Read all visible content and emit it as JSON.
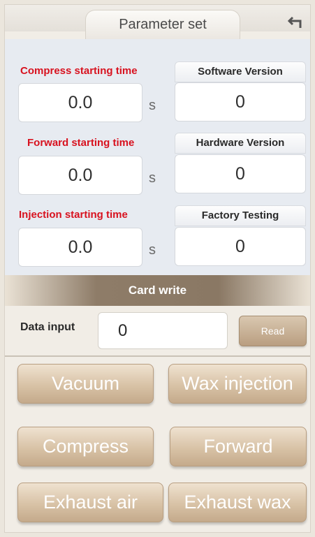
{
  "header": {
    "title": "Parameter set",
    "back_icon": "back-arrow-icon"
  },
  "params": {
    "compress": {
      "label": "Compress starting time",
      "value": "0.0",
      "unit": "s"
    },
    "forward": {
      "label": "Forward starting time",
      "value": "0.0",
      "unit": "s"
    },
    "injection": {
      "label": "Injection starting time",
      "value": "0.0",
      "unit": "s"
    }
  },
  "info": {
    "software": {
      "label": "Software Version",
      "value": "0"
    },
    "hardware": {
      "label": "Hardware Version",
      "value": "0"
    },
    "factory": {
      "label": "Factory Testing",
      "value": "0"
    }
  },
  "card": {
    "title": "Card write",
    "data_label": "Data input",
    "data_value": "0",
    "read_label": "Read"
  },
  "buttons": {
    "vacuum": "Vacuum",
    "wax_injection": "Wax injection",
    "compress": "Compress",
    "forward": "Forward",
    "exhaust_air": "Exhaust air",
    "exhaust_wax": "Exhaust wax"
  },
  "colors": {
    "label_red": "#d8121f",
    "panel_blue": "#e7ebf1",
    "button_tan": "#d8c2a6",
    "band_brown": "#8e7c68"
  }
}
